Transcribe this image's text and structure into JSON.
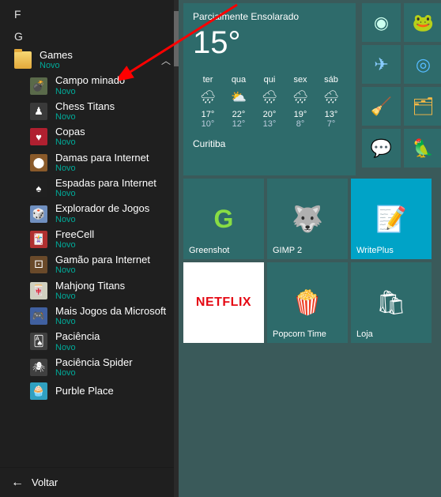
{
  "letters": {
    "f": "F",
    "g": "G"
  },
  "folder": {
    "name": "Games",
    "new": "Novo"
  },
  "apps": [
    {
      "name": "Campo minado",
      "new": "Novo",
      "bg": "#5a6a4a",
      "glyph": "💣"
    },
    {
      "name": "Chess Titans",
      "new": "Novo",
      "bg": "#3a3a3a",
      "glyph": "♟"
    },
    {
      "name": "Copas",
      "new": "Novo",
      "bg": "#b02030",
      "glyph": "♥"
    },
    {
      "name": "Damas para Internet",
      "new": "Novo",
      "bg": "#8a5a2a",
      "glyph": "⬤"
    },
    {
      "name": "Espadas para Internet",
      "new": "Novo",
      "bg": "#202020",
      "glyph": "♠"
    },
    {
      "name": "Explorador de Jogos",
      "new": "Novo",
      "bg": "#7090c0",
      "glyph": "🎲"
    },
    {
      "name": "FreeCell",
      "new": "Novo",
      "bg": "#b03030",
      "glyph": "🃏"
    },
    {
      "name": "Gamão para Internet",
      "new": "Novo",
      "bg": "#6a4a2a",
      "glyph": "⚀"
    },
    {
      "name": "Mahjong Titans",
      "new": "Novo",
      "bg": "#d0d0c0",
      "glyph": "🀄"
    },
    {
      "name": "Mais Jogos da Microsoft",
      "new": "Novo",
      "bg": "#4060a0",
      "glyph": "🎮"
    },
    {
      "name": "Paciência",
      "new": "Novo",
      "bg": "#404040",
      "glyph": "🂡"
    },
    {
      "name": "Paciência Spider",
      "new": "Novo",
      "bg": "#404040",
      "glyph": "🕷"
    },
    {
      "name": "Purble Place",
      "new": "",
      "bg": "#30a0c0",
      "glyph": "🧁"
    }
  ],
  "back": "Voltar",
  "weather": {
    "condition": "Parcialmente Ensolarado",
    "temp": "15°",
    "city": "Curitiba",
    "days": [
      {
        "d": "ter",
        "icon": "🌧",
        "hi": "17°",
        "lo": "10°"
      },
      {
        "d": "qua",
        "icon": "⛅",
        "hi": "22°",
        "lo": "12°"
      },
      {
        "d": "qui",
        "icon": "🌧",
        "hi": "20°",
        "lo": "13°"
      },
      {
        "d": "sex",
        "icon": "🌧",
        "hi": "19°",
        "lo": "8°"
      },
      {
        "d": "sáb",
        "icon": "🌧",
        "hi": "13°",
        "lo": "7°"
      }
    ]
  },
  "small_tiles": [
    {
      "name": "steam",
      "glyph": "◉",
      "bg": "#2e6b6b",
      "fg": "#cfe"
    },
    {
      "name": "torrent-frog",
      "glyph": "🐸",
      "bg": "#2e6b6b",
      "fg": "#fff"
    },
    {
      "name": "plane",
      "glyph": "✈",
      "bg": "#2e6b6b",
      "fg": "#8cf"
    },
    {
      "name": "qbittorrent",
      "glyph": "◎",
      "bg": "#2e6b6b",
      "fg": "#5bf"
    },
    {
      "name": "ccleaner",
      "glyph": "🧹",
      "bg": "#2e6b6b",
      "fg": "#f44"
    },
    {
      "name": "utility",
      "glyph": "🗂",
      "bg": "#2e6b6b",
      "fg": "#fb4"
    },
    {
      "name": "chat",
      "glyph": "💬",
      "bg": "#2e6b6b",
      "fg": "#3cf"
    },
    {
      "name": "bird",
      "glyph": "🦜",
      "bg": "#2e6b6b",
      "fg": "#fc4"
    }
  ],
  "med_tiles": [
    {
      "name": "Greenshot",
      "bg": "#2e6b6b",
      "glyph": "G",
      "glyphColor": "#8d4"
    },
    {
      "name": "GIMP 2",
      "bg": "#2e6b6b",
      "glyph": "🐺",
      "glyphColor": "#b98"
    },
    {
      "name": "WritePlus",
      "bg": "#00a3c7",
      "glyph": "📝",
      "glyphColor": "#fff"
    }
  ],
  "row2_tiles": [
    {
      "name": "",
      "bg": "#fff",
      "glyph": "NETFLIX",
      "text": true
    },
    {
      "name": "Popcorn Time",
      "bg": "#2e6b6b",
      "glyph": "🍿",
      "glyphColor": "#fff"
    },
    {
      "name": "Loja",
      "bg": "#2e6b6b",
      "glyph": "🛍",
      "glyphColor": "#fff"
    }
  ]
}
